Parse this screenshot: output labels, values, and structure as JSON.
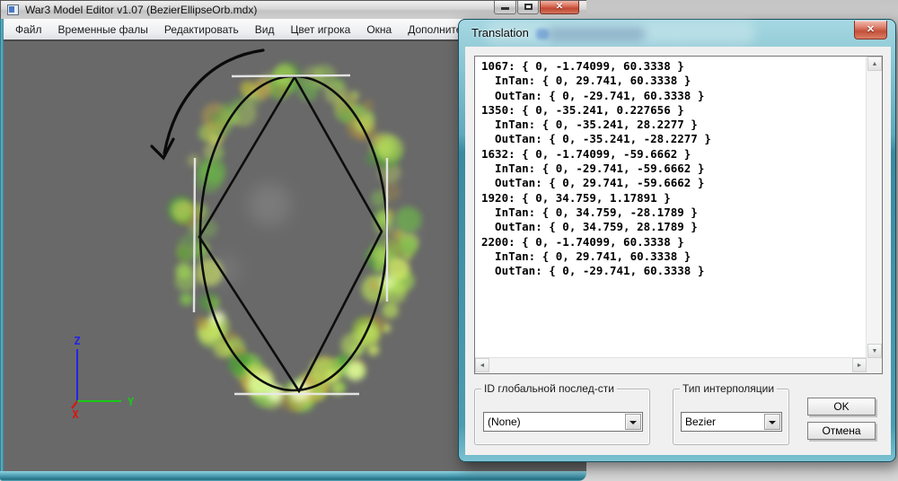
{
  "colors": {
    "viewport_bg": "#696969",
    "aero_teal": "#4d9cb0",
    "close_red": "#c4503a",
    "dialog_client": "#f0f0f0"
  },
  "main_window": {
    "title": "War3 Model Editor v1.07 (BezierEllipseOrb.mdx)",
    "menu": [
      "Файл",
      "Временные фалы",
      "Редактировать",
      "Вид",
      "Цвет игрока",
      "Окна",
      "Дополнительно"
    ],
    "close_glyph": "✕"
  },
  "viewport": {
    "particle_palette": [
      "#4f9e38",
      "#6ab945",
      "#83c94f",
      "#9ed455",
      "#b7dd5c",
      "#cfe765",
      "#b3913f",
      "#c7a847"
    ],
    "highlight_palette": [
      "#e4ff9e",
      "#f2ffc8"
    ],
    "axis": {
      "x_label": "X",
      "y_label": "Y",
      "z_label": "Z",
      "x_color": "#e01010",
      "y_color": "#18c818",
      "z_color": "#2424e8"
    }
  },
  "dialog": {
    "title": "Translation",
    "close_glyph": "✕",
    "keyframes": [
      "1067: { 0, -1.74099, 60.3338 }",
      "  InTan: { 0, 29.741, 60.3338 }",
      "  OutTan: { 0, -29.741, 60.3338 }",
      "1350: { 0, -35.241, 0.227656 }",
      "  InTan: { 0, -35.241, 28.2277 }",
      "  OutTan: { 0, -35.241, -28.2277 }",
      "1632: { 0, -1.74099, -59.6662 }",
      "  InTan: { 0, -29.741, -59.6662 }",
      "  OutTan: { 0, 29.741, -59.6662 }",
      "1920: { 0, 34.759, 1.17891 }",
      "  InTan: { 0, 34.759, -28.1789 }",
      "  OutTan: { 0, 34.759, 28.1789 }",
      "2200: { 0, -1.74099, 60.3338 }",
      "  InTan: { 0, 29.741, 60.3338 }",
      "  OutTan: { 0, -29.741, 60.3338 }"
    ],
    "global_seq_group": {
      "label": "ID глобальной послед-сти",
      "value": "(None)"
    },
    "interp_group": {
      "label": "Тип интерполяции",
      "value": "Bezier"
    },
    "ok_label": "OK",
    "cancel_label": "Отмена",
    "scrollbar": {
      "up": "▲",
      "down": "▼",
      "left": "◄",
      "right": "►"
    }
  }
}
